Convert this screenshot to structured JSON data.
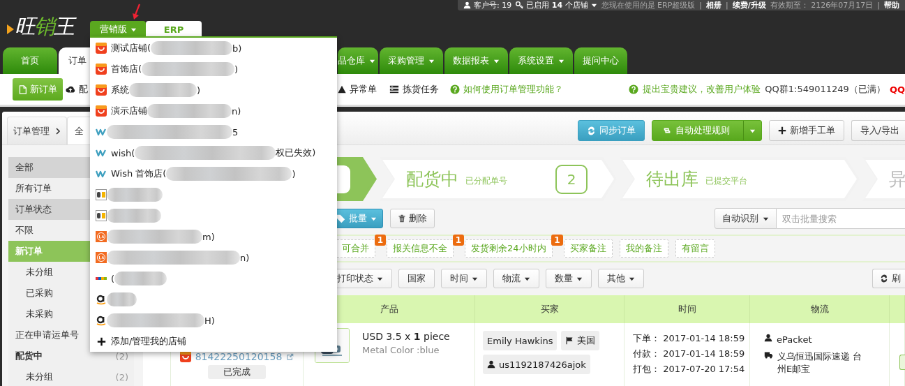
{
  "topbar": {
    "items": [
      {
        "kind": "account",
        "text": "客户号: 19"
      },
      {
        "kind": "stores",
        "text": "已启用 **14** 个店铺"
      },
      {
        "kind": "note",
        "text": "您现在使用的是 ERP超级版"
      },
      {
        "kind": "sep",
        "text": "|"
      },
      {
        "kind": "link",
        "text": "**相册**"
      },
      {
        "kind": "sep",
        "text": "|"
      },
      {
        "kind": "link",
        "text": "**续费/升级**"
      },
      {
        "kind": "note",
        "text": "有效期至： 2126年07月17日"
      },
      {
        "kind": "sep",
        "text": "|"
      },
      {
        "kind": "link",
        "text": "**帮助**"
      }
    ]
  },
  "logo": {
    "parts": [
      {
        "text": "旺",
        "highlighted": false
      },
      {
        "text": "销",
        "highlighted": true
      },
      {
        "text": "王",
        "highlighted": false
      }
    ]
  },
  "versions": [
    {
      "label": "营销版",
      "selected": true
    },
    {
      "label": "ERP",
      "selected": false
    }
  ],
  "nav_tabs": [
    {
      "label": "首页",
      "selected": false,
      "dropdown": false
    },
    {
      "label": "订单",
      "selected": true,
      "dropdown": false
    },
    {
      "label": "品仓库",
      "selected": false,
      "dropdown": true
    },
    {
      "label": "采购管理",
      "selected": false,
      "dropdown": true
    },
    {
      "label": "数据报表",
      "selected": false,
      "dropdown": true
    },
    {
      "label": "系统设置",
      "selected": false,
      "dropdown": true
    },
    {
      "label": "提问中心",
      "selected": false,
      "dropdown": false
    }
  ],
  "toolbar": {
    "new_order": "新订单",
    "items": [
      {
        "kind": "cloud",
        "label": "配"
      },
      {
        "kind": "warning",
        "label": "异常单"
      },
      {
        "kind": "list",
        "label": "拣货任务"
      },
      {
        "kind": "help",
        "label": "如何使用订单管理功能？"
      }
    ],
    "right": [
      {
        "kind": "help",
        "label": "提出宝贵建议，改善用户体验"
      },
      {
        "kind": "text",
        "label": "QQ群1:549011249（已满）"
      },
      {
        "kind": "alert",
        "label": "QQ"
      }
    ]
  },
  "breadcrumb": {
    "tabs": [
      {
        "label": "订单管理",
        "selected": false
      },
      {
        "label": "全",
        "selected": true
      }
    ]
  },
  "actions": [
    {
      "kind": "sync",
      "label": "同步订单"
    },
    {
      "kind": "rules",
      "label": "自动处理规则"
    },
    {
      "kind": "add",
      "label": "新增手工单"
    },
    {
      "kind": "import",
      "label": "导入/导出"
    }
  ],
  "sidebar": [
    {
      "kind": "header",
      "label": "全部"
    },
    {
      "kind": "item",
      "label": "所有订单",
      "selected": false
    },
    {
      "kind": "header",
      "label": "订单状态"
    },
    {
      "kind": "item",
      "label": "不限",
      "selected": false
    },
    {
      "kind": "item",
      "label": "新订单",
      "selected": true
    },
    {
      "kind": "sub",
      "label": "未分组",
      "selected": false
    },
    {
      "kind": "sub",
      "label": "已采购",
      "selected": false
    },
    {
      "kind": "sub",
      "label": "未采购",
      "selected": false
    },
    {
      "kind": "item",
      "label": "正在申请运单号",
      "selected": false
    },
    {
      "kind": "group",
      "label": "配货中",
      "count": "(2)",
      "selected": false
    },
    {
      "kind": "sub",
      "label": "未分组",
      "count": "(2)",
      "selected": false
    }
  ],
  "steps": [
    {
      "selected": true
    },
    {
      "title": "配货中",
      "subtitle": "已分配单号",
      "count": "2",
      "selected": false
    },
    {
      "title": "待出库",
      "subtitle": "已提交平台",
      "selected": false
    },
    {
      "title": "异",
      "selected": false
    }
  ],
  "batch": {
    "label": "批量"
  },
  "delete": {
    "label": "删除"
  },
  "search": {
    "mode": "自动识别",
    "placeholder": "双击批量搜索"
  },
  "quick_filters": [
    {
      "label": "可合并",
      "badge": "1"
    },
    {
      "label": "报关信息不全",
      "badge": "1"
    },
    {
      "label": "发货剩余24小时内",
      "badge": "1"
    },
    {
      "label": "买家备注"
    },
    {
      "label": "我的备注"
    },
    {
      "label": "有留言"
    }
  ],
  "filters": [
    {
      "label": "打印状态",
      "dropdown": true
    },
    {
      "label": "国家",
      "dropdown": false
    },
    {
      "label": "时间",
      "dropdown": true
    },
    {
      "label": "物流",
      "dropdown": true
    },
    {
      "label": "数量",
      "dropdown": true
    },
    {
      "label": "其他",
      "dropdown": true
    }
  ],
  "refresh": {
    "label": "刷"
  },
  "table": {
    "columns": [
      "产品",
      "买家",
      "时间",
      "物流"
    ],
    "rows": [
      {
        "order_no": "81422250120158",
        "status": "已完成",
        "price": "USD 3.5 x **1** piece",
        "variant": "Metal Color :blue",
        "buyer": "Emily Hawkins",
        "country": "美国",
        "buyer_id": "us1192187426ajok",
        "times": [
          "下单： 2017-01-14 18:59",
          "付款： 2017-01-14 18:59",
          "打包： 2017-07-20 17:54"
        ],
        "shipping": "ePacket",
        "carrier": "义乌恒迅国际速递 台州E邮宝"
      }
    ]
  },
  "store_menu": {
    "items": [
      {
        "kind": "aliexpress",
        "prefix": "测试店铺(",
        "suffix": "b)"
      },
      {
        "kind": "aliexpress",
        "prefix": "首饰店(",
        "suffix": ")"
      },
      {
        "kind": "aliexpress",
        "prefix": "系统",
        "suffix": ")"
      },
      {
        "kind": "aliexpress",
        "prefix": "演示店铺",
        "suffix": "n)"
      },
      {
        "kind": "wish",
        "suffix": "5"
      },
      {
        "kind": "wish",
        "prefix": "wish(",
        "suffix": "权已失效)"
      },
      {
        "kind": "wish",
        "prefix": "Wish 首饰店(",
        "suffix": ")"
      },
      {
        "kind": "dh"
      },
      {
        "kind": "dh"
      },
      {
        "kind": "lazada",
        "suffix": "m)"
      },
      {
        "kind": "lazada",
        "suffix": "n)"
      },
      {
        "kind": "ebay",
        "prefix": "("
      },
      {
        "kind": "amazon"
      },
      {
        "kind": "amazon",
        "suffix": "H)"
      }
    ],
    "add_label": "添加/管理我的店铺"
  }
}
